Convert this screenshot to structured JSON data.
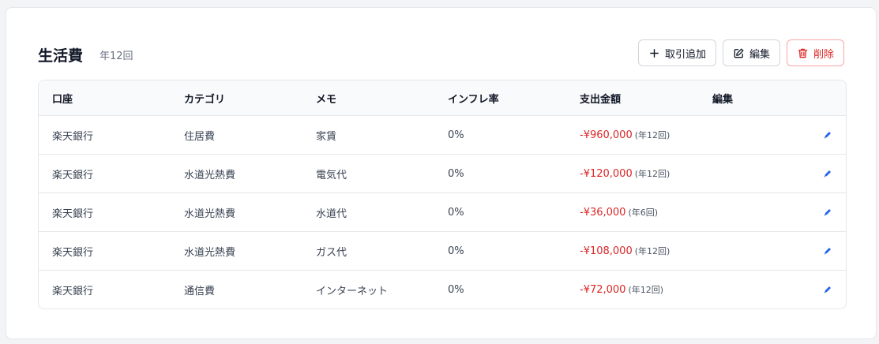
{
  "section": {
    "title": "生活費",
    "subtitle": "年12回"
  },
  "actions": {
    "add_label": "取引追加",
    "edit_label": "編集",
    "delete_label": "削除"
  },
  "table": {
    "headers": [
      "口座",
      "カテゴリ",
      "メモ",
      "インフレ率",
      "支出金額",
      "編集"
    ],
    "rows": [
      {
        "account": "楽天銀行",
        "category": "住居費",
        "memo": "家賃",
        "inflation": "0%",
        "amount": "-¥960,000",
        "frequency": "(年12回)"
      },
      {
        "account": "楽天銀行",
        "category": "水道光熱費",
        "memo": "電気代",
        "inflation": "0%",
        "amount": "-¥120,000",
        "frequency": "(年12回)"
      },
      {
        "account": "楽天銀行",
        "category": "水道光熱費",
        "memo": "水道代",
        "inflation": "0%",
        "amount": "-¥36,000",
        "frequency": "(年6回)"
      },
      {
        "account": "楽天銀行",
        "category": "水道光熱費",
        "memo": "ガス代",
        "inflation": "0%",
        "amount": "-¥108,000",
        "frequency": "(年12回)"
      },
      {
        "account": "楽天銀行",
        "category": "通信費",
        "memo": "インターネット",
        "inflation": "0%",
        "amount": "-¥72,000",
        "frequency": "(年12回)"
      }
    ]
  },
  "icons": {
    "add": "plus-icon",
    "edit": "edit-square-icon",
    "delete": "trash-icon",
    "row_edit": "pencil-icon"
  },
  "colors": {
    "expense": "#dc2626",
    "danger": "#dc2626",
    "row_edit_icon": "#2563eb"
  }
}
